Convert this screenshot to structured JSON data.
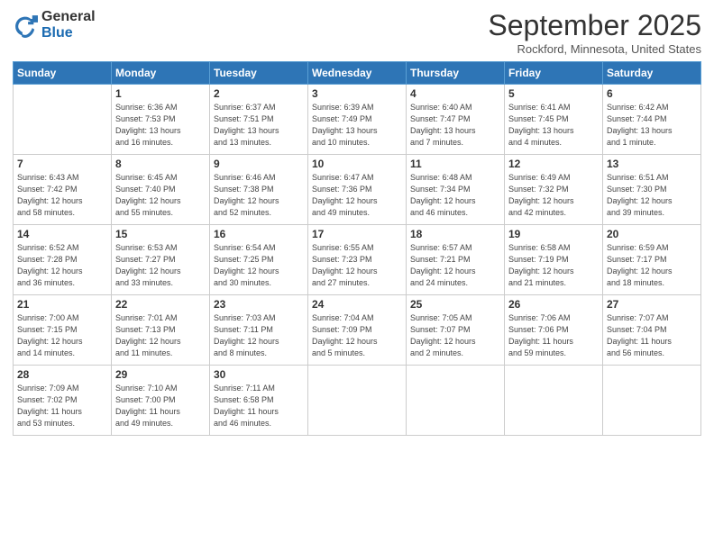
{
  "logo": {
    "general": "General",
    "blue": "Blue"
  },
  "title": "September 2025",
  "location": "Rockford, Minnesota, United States",
  "weekdays": [
    "Sunday",
    "Monday",
    "Tuesday",
    "Wednesday",
    "Thursday",
    "Friday",
    "Saturday"
  ],
  "weeks": [
    [
      {
        "day": "",
        "info": ""
      },
      {
        "day": "1",
        "info": "Sunrise: 6:36 AM\nSunset: 7:53 PM\nDaylight: 13 hours\nand 16 minutes."
      },
      {
        "day": "2",
        "info": "Sunrise: 6:37 AM\nSunset: 7:51 PM\nDaylight: 13 hours\nand 13 minutes."
      },
      {
        "day": "3",
        "info": "Sunrise: 6:39 AM\nSunset: 7:49 PM\nDaylight: 13 hours\nand 10 minutes."
      },
      {
        "day": "4",
        "info": "Sunrise: 6:40 AM\nSunset: 7:47 PM\nDaylight: 13 hours\nand 7 minutes."
      },
      {
        "day": "5",
        "info": "Sunrise: 6:41 AM\nSunset: 7:45 PM\nDaylight: 13 hours\nand 4 minutes."
      },
      {
        "day": "6",
        "info": "Sunrise: 6:42 AM\nSunset: 7:44 PM\nDaylight: 13 hours\nand 1 minute."
      }
    ],
    [
      {
        "day": "7",
        "info": "Sunrise: 6:43 AM\nSunset: 7:42 PM\nDaylight: 12 hours\nand 58 minutes."
      },
      {
        "day": "8",
        "info": "Sunrise: 6:45 AM\nSunset: 7:40 PM\nDaylight: 12 hours\nand 55 minutes."
      },
      {
        "day": "9",
        "info": "Sunrise: 6:46 AM\nSunset: 7:38 PM\nDaylight: 12 hours\nand 52 minutes."
      },
      {
        "day": "10",
        "info": "Sunrise: 6:47 AM\nSunset: 7:36 PM\nDaylight: 12 hours\nand 49 minutes."
      },
      {
        "day": "11",
        "info": "Sunrise: 6:48 AM\nSunset: 7:34 PM\nDaylight: 12 hours\nand 46 minutes."
      },
      {
        "day": "12",
        "info": "Sunrise: 6:49 AM\nSunset: 7:32 PM\nDaylight: 12 hours\nand 42 minutes."
      },
      {
        "day": "13",
        "info": "Sunrise: 6:51 AM\nSunset: 7:30 PM\nDaylight: 12 hours\nand 39 minutes."
      }
    ],
    [
      {
        "day": "14",
        "info": "Sunrise: 6:52 AM\nSunset: 7:28 PM\nDaylight: 12 hours\nand 36 minutes."
      },
      {
        "day": "15",
        "info": "Sunrise: 6:53 AM\nSunset: 7:27 PM\nDaylight: 12 hours\nand 33 minutes."
      },
      {
        "day": "16",
        "info": "Sunrise: 6:54 AM\nSunset: 7:25 PM\nDaylight: 12 hours\nand 30 minutes."
      },
      {
        "day": "17",
        "info": "Sunrise: 6:55 AM\nSunset: 7:23 PM\nDaylight: 12 hours\nand 27 minutes."
      },
      {
        "day": "18",
        "info": "Sunrise: 6:57 AM\nSunset: 7:21 PM\nDaylight: 12 hours\nand 24 minutes."
      },
      {
        "day": "19",
        "info": "Sunrise: 6:58 AM\nSunset: 7:19 PM\nDaylight: 12 hours\nand 21 minutes."
      },
      {
        "day": "20",
        "info": "Sunrise: 6:59 AM\nSunset: 7:17 PM\nDaylight: 12 hours\nand 18 minutes."
      }
    ],
    [
      {
        "day": "21",
        "info": "Sunrise: 7:00 AM\nSunset: 7:15 PM\nDaylight: 12 hours\nand 14 minutes."
      },
      {
        "day": "22",
        "info": "Sunrise: 7:01 AM\nSunset: 7:13 PM\nDaylight: 12 hours\nand 11 minutes."
      },
      {
        "day": "23",
        "info": "Sunrise: 7:03 AM\nSunset: 7:11 PM\nDaylight: 12 hours\nand 8 minutes."
      },
      {
        "day": "24",
        "info": "Sunrise: 7:04 AM\nSunset: 7:09 PM\nDaylight: 12 hours\nand 5 minutes."
      },
      {
        "day": "25",
        "info": "Sunrise: 7:05 AM\nSunset: 7:07 PM\nDaylight: 12 hours\nand 2 minutes."
      },
      {
        "day": "26",
        "info": "Sunrise: 7:06 AM\nSunset: 7:06 PM\nDaylight: 11 hours\nand 59 minutes."
      },
      {
        "day": "27",
        "info": "Sunrise: 7:07 AM\nSunset: 7:04 PM\nDaylight: 11 hours\nand 56 minutes."
      }
    ],
    [
      {
        "day": "28",
        "info": "Sunrise: 7:09 AM\nSunset: 7:02 PM\nDaylight: 11 hours\nand 53 minutes."
      },
      {
        "day": "29",
        "info": "Sunrise: 7:10 AM\nSunset: 7:00 PM\nDaylight: 11 hours\nand 49 minutes."
      },
      {
        "day": "30",
        "info": "Sunrise: 7:11 AM\nSunset: 6:58 PM\nDaylight: 11 hours\nand 46 minutes."
      },
      {
        "day": "",
        "info": ""
      },
      {
        "day": "",
        "info": ""
      },
      {
        "day": "",
        "info": ""
      },
      {
        "day": "",
        "info": ""
      }
    ]
  ]
}
